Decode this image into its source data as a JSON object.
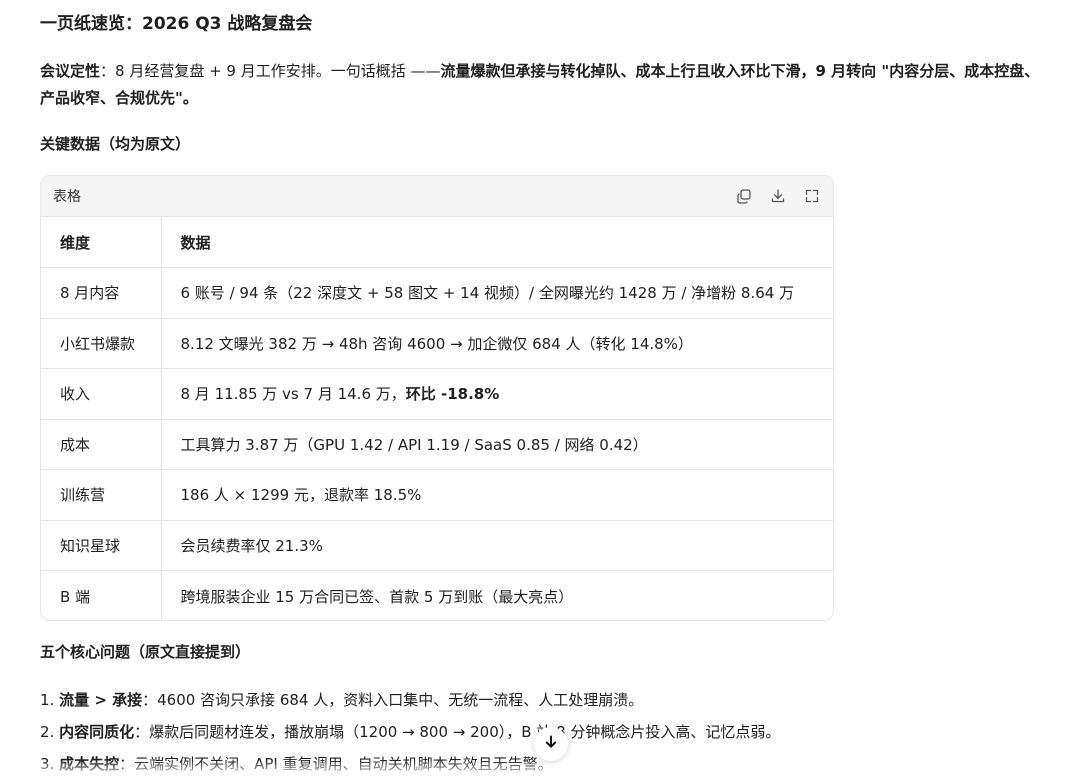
{
  "doc": {
    "title": "一页纸速览：2026 Q3 战略复盘会",
    "summary": {
      "label": "会议定性",
      "text1": "：8 月经营复盘 + 9 月工作安排。一句话概括 ——",
      "bold": "流量爆款但承接与转化掉队、成本上行且收入环比下滑，9 月转向 \"内容分层、成本控盘、产品收窄、合规优先\"。"
    },
    "key_data_heading": "关键数据（均为原文）",
    "issues_heading": "五个核心问题（原文直接提到）"
  },
  "table": {
    "card_label": "表格",
    "icons": [
      "copy-icon",
      "download-icon",
      "expand-icon"
    ],
    "headers": [
      "维度",
      "数据"
    ],
    "rows": [
      {
        "k": "8 月内容",
        "v": "6 账号 / 94 条（22 深度文 + 58 图文 + 14 视频）/ 全网曝光约 1428 万 / 净增粉 8.64 万"
      },
      {
        "k": "小红书爆款",
        "v": "8.12 文曝光 382 万 → 48h 咨询 4600 → 加企微仅 684 人（转化 14.8%）"
      },
      {
        "k": "收入",
        "v": "8 月 11.85 万 vs 7 月 14.6 万，",
        "vb": "环比 -18.8%"
      },
      {
        "k": "成本",
        "v": "工具算力 3.87 万（GPU 1.42 / API 1.19 / SaaS 0.85 / 网络 0.42）"
      },
      {
        "k": "训练营",
        "v": "186 人 × 1299 元，退款率 18.5%"
      },
      {
        "k": "知识星球",
        "v": "会员续费率仅 21.3%"
      },
      {
        "k": "B 端",
        "v": "跨境服装企业 15 万合同已签、首款 5 万到账（最大亮点）"
      }
    ]
  },
  "issues": [
    {
      "n": "1.",
      "b": "流量 > 承接",
      "t": "：4600 咨询只承接 684 人，资料入口集中、无统一流程、人工处理崩溃。"
    },
    {
      "n": "2.",
      "b": "内容同质化",
      "t": "：爆款后同题材连发，播放崩塌（1200 → 800 → 200），B 站 8 分钟概念片投入高、记忆点弱。"
    },
    {
      "n": "3.",
      "b": "成本失控",
      "t": "：云端实例不关闭、API 重复调用、自动关机脚本失效且无告警。"
    }
  ],
  "scroll_button": {
    "icon": "arrow-down-icon"
  }
}
